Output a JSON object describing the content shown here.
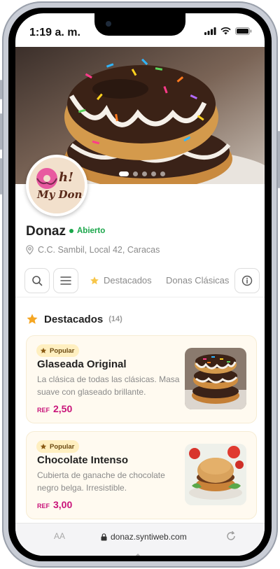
{
  "status_bar": {
    "time": "1:19 a. m."
  },
  "store": {
    "name": "Donaz",
    "status": "Abierto",
    "address": "C.C. Sambil, Local 42, Caracas",
    "logo_text": "Oh! My Dona!"
  },
  "hero": {
    "slides": 5,
    "active_slide": 1
  },
  "nav": {
    "tabs": [
      {
        "label": "Destacados",
        "icon": "star-icon"
      },
      {
        "label": "Donas Clásicas"
      }
    ]
  },
  "section": {
    "title": "Destacados",
    "count": "(14)"
  },
  "products": [
    {
      "badge": "Popular",
      "name": "Glaseada Original",
      "description": "La clásica de todas las clásicas. Masa suave con glaseado brillante.",
      "currency": "REF",
      "price": "2,50"
    },
    {
      "badge": "Popular",
      "name": "Chocolate Intenso",
      "description": "Cubierta de ganache de chocolate negro belga. Irresistible.",
      "currency": "REF",
      "price": "3,00"
    }
  ],
  "browser": {
    "text_size": "AA",
    "url": "donaz.syntiweb.com"
  },
  "colors": {
    "accent": "#c9147a",
    "open": "#1aa64a",
    "star": "#f5a623"
  }
}
